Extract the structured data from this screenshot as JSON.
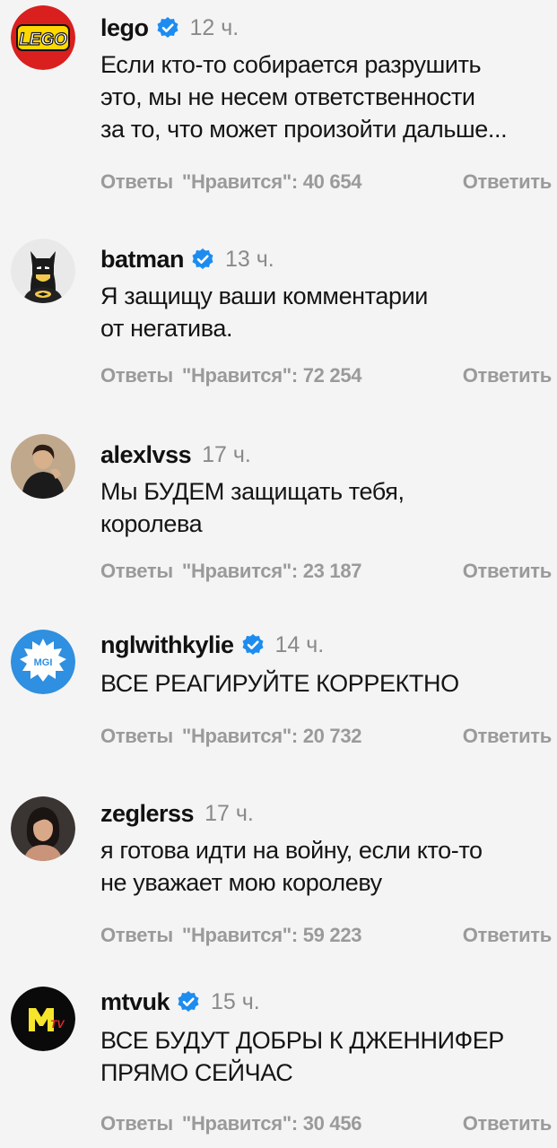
{
  "labels": {
    "replies": "Ответы",
    "reply": "Ответить"
  },
  "comments": [
    {
      "username": "lego",
      "verified": true,
      "avatar": "lego-logo",
      "time": "12 ч.",
      "text": "Если кто-то собирается разрушить\nэто, мы не несем ответственности\nза то, что может произойти дальше...",
      "likes": "\"Нравится\": 40 654"
    },
    {
      "username": "batman",
      "verified": true,
      "avatar": "lego-batman-minifigure",
      "time": "13 ч.",
      "text": "Я защищу ваши комментарии\nот негатива.",
      "likes": "\"Нравится\": 72 254"
    },
    {
      "username": "alexlvss",
      "verified": false,
      "avatar": "person-photo",
      "time": "17 ч.",
      "text": "Мы БУДЕМ защищать тебя,\nкоролева",
      "likes": "\"Нравится\": 23 187"
    },
    {
      "username": "nglwithkylie",
      "verified": true,
      "avatar": "mgi-badge",
      "time": "14 ч.",
      "text": "ВСЕ РЕАГИРУЙТЕ КОРРЕКТНО",
      "likes": "\"Нравится\": 20 732"
    },
    {
      "username": "zeglerss",
      "verified": false,
      "avatar": "person-photo",
      "time": "17 ч.",
      "text": "я готова идти на войну, если кто-то\nне уважает мою королеву",
      "likes": "\"Нравится\": 59 223"
    },
    {
      "username": "mtvuk",
      "verified": true,
      "avatar": "mtv-logo",
      "time": "15 ч.",
      "text": "ВСЕ БУДУТ ДОБРЫ К ДЖЕННИФЕР\nПРЯМО СЕЙЧАС",
      "likes": "\"Нравится\": 30 456"
    }
  ],
  "colors": {
    "background": "#f4f4f4",
    "verified_blue": "#1d8cf0",
    "meta_gray": "#9a9a9a"
  }
}
